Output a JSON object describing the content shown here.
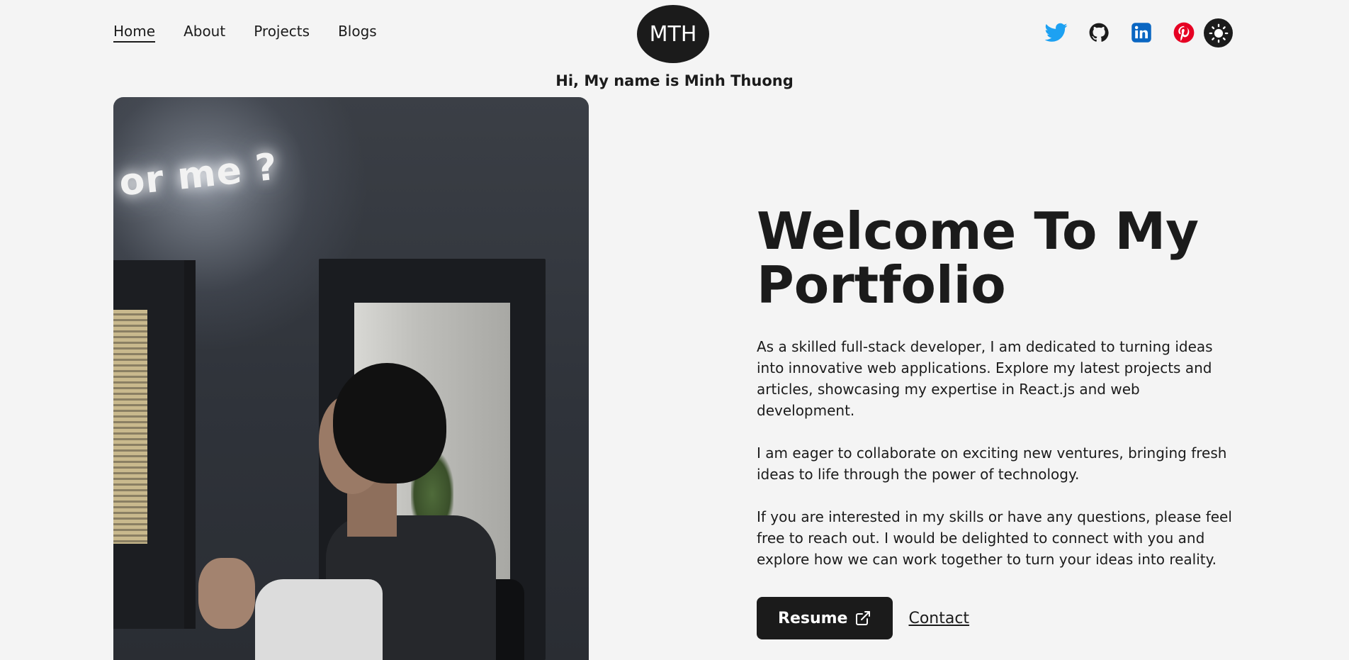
{
  "nav": {
    "items": [
      {
        "label": "Home",
        "active": true
      },
      {
        "label": "About"
      },
      {
        "label": "Projects"
      },
      {
        "label": "Blogs"
      }
    ]
  },
  "logo": {
    "text": "MTH"
  },
  "greeting": "Hi, My name is Minh Thuong",
  "socials": [
    {
      "icon": "twitter-icon",
      "color": "#1da1f2"
    },
    {
      "icon": "github-icon",
      "color": "#1b1b1b"
    },
    {
      "icon": "linkedin-icon",
      "color": "#0a66c2"
    },
    {
      "icon": "pinterest-icon",
      "color": "#e60023"
    }
  ],
  "theme_toggle": {
    "icon": "sun-icon"
  },
  "photo": {
    "neon_text": "or me ?"
  },
  "hero": {
    "title": "Welcome To My Portfolio",
    "paragraphs": [
      "As a skilled full-stack developer, I am dedicated to turning ideas into innovative web applications. Explore my latest projects and articles, showcasing my expertise in React.js and web development.",
      "I am eager to collaborate on exciting new ventures, bringing fresh ideas to life through the power of technology.",
      "If you are interested in my skills or have any questions, please feel free to reach out. I would be delighted to connect with you and explore how we can work together to turn your ideas into reality."
    ],
    "resume_label": "Resume",
    "contact_label": "Contact"
  },
  "colors": {
    "background": "#f4f4f4",
    "dark": "#1b1b1b"
  }
}
